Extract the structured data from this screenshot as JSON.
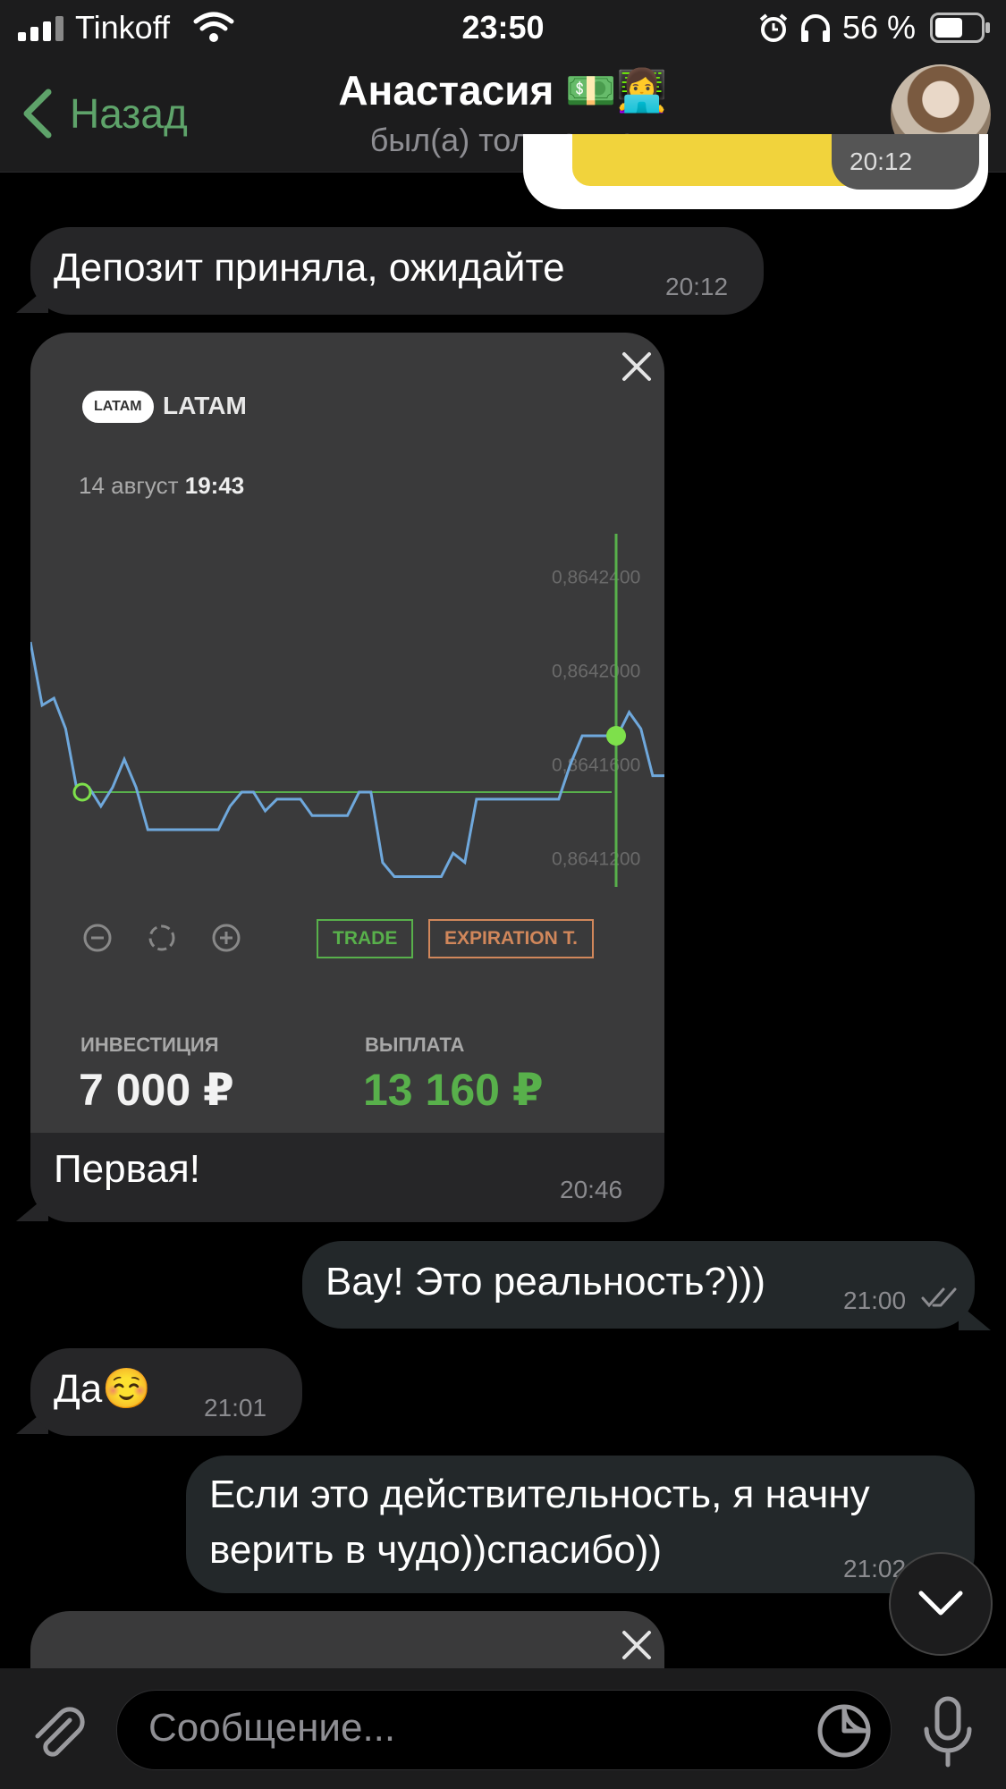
{
  "status_bar": {
    "carrier": "Tinkoff",
    "time": "23:50",
    "battery_percent": "56 %"
  },
  "header": {
    "back_label": "Назад",
    "contact_name": "Анастасия 💵👩‍💻",
    "contact_status": "был(а) только что"
  },
  "messages": [
    {
      "text": "Депозит приняла, ожидайте",
      "time": "20:12"
    },
    {
      "caption": "Первая!",
      "time": "20:46"
    },
    {
      "text": "Вау! Это реальность?)))",
      "time": "21:00"
    },
    {
      "text": "Да☺️",
      "time": "21:01"
    },
    {
      "text_line1": "Если это действительность, я начну",
      "text_line2": "верить в чудо))спасибо))",
      "time": "21:02"
    }
  ],
  "top_partial": {
    "time": "20:12"
  },
  "trade_card": {
    "asset_badge": "LATAM",
    "asset_name": "LATAM",
    "date": "14 август",
    "time": "19:43",
    "trade_button": "TRADE",
    "expiration_button": "EXPIRATION T.",
    "invest_label": "ИНВЕСТИЦИЯ",
    "invest_value": "7 000 ₽",
    "payout_label": "ВЫПЛАТА",
    "payout_value": "13 160 ₽"
  },
  "chart_data": {
    "type": "line",
    "y_ticks": [
      "0,8642400",
      "0,8642000",
      "0,8641600",
      "0,8641200"
    ],
    "ylim": [
      0.8641,
      0.86426
    ],
    "values": [
      0.864212,
      0.864185,
      0.864188,
      0.864175,
      0.864148,
      0.86415,
      0.864142,
      0.86415,
      0.864162,
      0.86415,
      0.864132,
      0.864132,
      0.864132,
      0.864132,
      0.864132,
      0.864132,
      0.864132,
      0.864142,
      0.864148,
      0.864148,
      0.86414,
      0.864145,
      0.864145,
      0.864145,
      0.864138,
      0.864138,
      0.864138,
      0.864138,
      0.864148,
      0.864148,
      0.864118,
      0.864112,
      0.864112,
      0.864112,
      0.864112,
      0.864112,
      0.864122,
      0.864118,
      0.864145,
      0.864145,
      0.864145,
      0.864145,
      0.864145,
      0.864145,
      0.864145,
      0.864145,
      0.86416,
      0.864172,
      0.864172,
      0.864172,
      0.864172,
      0.864182,
      0.864175,
      0.864155,
      0.864155
    ],
    "open_value": 0.864148,
    "current_value": 0.864172,
    "colors": {
      "line": "#6fa8dc",
      "level": "#58b04b",
      "point": "#7ee04b"
    }
  },
  "composer": {
    "placeholder": "Сообщение..."
  },
  "icons": [
    "signal-icon",
    "wifi-icon",
    "alarm-icon",
    "headphones-icon",
    "battery-icon",
    "back-chevron-icon",
    "close-icon",
    "zoom-out-icon",
    "fit-icon",
    "zoom-in-icon",
    "paperclip-icon",
    "sticker-icon",
    "microphone-icon",
    "chevron-down-icon",
    "read-check-icon"
  ],
  "colors": {
    "accent": "#5ea36a",
    "bubble_in": "#262628",
    "bubble_out": "#23282a",
    "payout": "#58b04b"
  }
}
